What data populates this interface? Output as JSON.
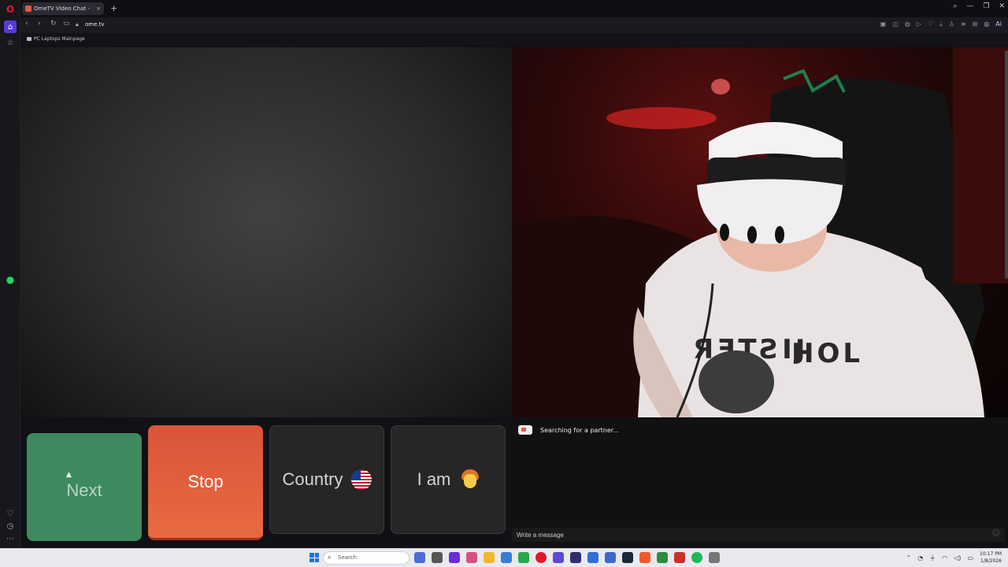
{
  "browser": {
    "tab": {
      "title": "OmeTV Video Chat -"
    },
    "url": "ome.tv",
    "bookmark": "PC Laptops Mainpage",
    "new_tab_symbol": "+",
    "aria_label": "Ai"
  },
  "controls": {
    "next_label": "Next",
    "stop_label": "Stop",
    "country_label": "Country",
    "iam_label": "I am"
  },
  "chat": {
    "status": "Searching for a partner...",
    "input_placeholder": "Write a message"
  },
  "taskbar": {
    "search_placeholder": "Search",
    "time": "10:17 PM",
    "date": "1/8/2026"
  },
  "colors": {
    "next": "#3d8a5f",
    "stop": "#e35a3c",
    "opera_red": "#e0182a",
    "sidebar_accent": "#5a3ad6"
  },
  "icons": {
    "sidebar": [
      "opera-logo-icon",
      "home-icon",
      "star-icon",
      "spotify-icon",
      "heart-icon",
      "history-icon",
      "more-icon"
    ],
    "country_flag": "us-flag-icon",
    "iam_avatar": "boy-face-icon"
  }
}
